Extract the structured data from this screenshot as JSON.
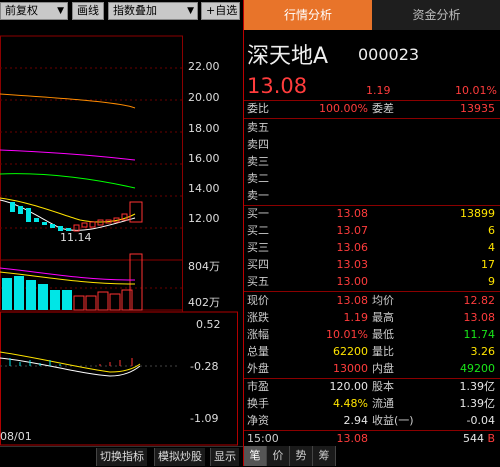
{
  "toolbar": {
    "adjust_label": "前复权",
    "line_label": "画线",
    "overlay_label": "指数叠加",
    "custom_label": "+自选"
  },
  "chart": {
    "price_axis": [
      "22.00",
      "20.00",
      "18.00",
      "16.00",
      "14.00",
      "12.00"
    ],
    "low_label": "11.14",
    "vol_axis": [
      "804万",
      "402万"
    ],
    "macd_axis": [
      "0.52",
      "-0.28",
      "-1.09"
    ],
    "date_label": "08/01",
    "colors": {
      "up": "#ff3232",
      "down": "#00e6e6",
      "ma5": "#ffffff",
      "ma10": "#ffe400",
      "ma20": "#ff00ff",
      "ma60": "#00ff00",
      "ma120": "#ff8c00"
    }
  },
  "bottombar": {
    "switch_label": "切换指标",
    "sim_label": "模拟炒股",
    "show_label": "显示"
  },
  "panel": {
    "tab_active": "行情分析",
    "tab_other": "资金分析",
    "name": "深天地A",
    "code": "000023",
    "price": "13.08",
    "change": "1.19",
    "change_pct": "10.01%",
    "weibi_label": "委比",
    "weibi": "100.00%",
    "weicha_label": "委差",
    "weicha": "13935",
    "asks": [
      {
        "label": "卖五",
        "price": "",
        "vol": ""
      },
      {
        "label": "卖四",
        "price": "",
        "vol": ""
      },
      {
        "label": "卖三",
        "price": "",
        "vol": ""
      },
      {
        "label": "卖二",
        "price": "",
        "vol": ""
      },
      {
        "label": "卖一",
        "price": "",
        "vol": ""
      }
    ],
    "bids": [
      {
        "label": "买一",
        "price": "13.08",
        "vol": "13899"
      },
      {
        "label": "买二",
        "price": "13.07",
        "vol": "6"
      },
      {
        "label": "买三",
        "price": "13.06",
        "vol": "4"
      },
      {
        "label": "买四",
        "price": "13.03",
        "vol": "17"
      },
      {
        "label": "买五",
        "price": "13.00",
        "vol": "9"
      }
    ],
    "stats": [
      {
        "l1": "现价",
        "v1": "13.08",
        "c1": "red",
        "l2": "均价",
        "v2": "12.82",
        "c2": "red"
      },
      {
        "l1": "涨跌",
        "v1": "1.19",
        "c1": "red",
        "l2": "最高",
        "v2": "13.08",
        "c2": "red"
      },
      {
        "l1": "涨幅",
        "v1": "10.01%",
        "c1": "red",
        "l2": "最低",
        "v2": "11.74",
        "c2": "grn"
      },
      {
        "l1": "总量",
        "v1": "62200",
        "c1": "yel",
        "l2": "量比",
        "v2": "3.26",
        "c2": "yel"
      },
      {
        "l1": "外盘",
        "v1": "13000",
        "c1": "red",
        "l2": "内盘",
        "v2": "49200",
        "c2": "grn"
      },
      {
        "l1": "市盈",
        "v1": "120.00",
        "c1": "wht",
        "l2": "股本",
        "v2": "1.39亿",
        "c2": "wht"
      },
      {
        "l1": "换手",
        "v1": "4.48%",
        "c1": "yel",
        "l2": "流通",
        "v2": "1.39亿",
        "c2": "wht"
      },
      {
        "l1": "净资",
        "v1": "2.94",
        "c1": "wht",
        "l2": "收益(一)",
        "v2": "-0.04",
        "c2": "wht"
      }
    ],
    "last_trade": {
      "time": "15:00",
      "price": "13.08",
      "vol": "544",
      "side": "B"
    },
    "footer_tabs": [
      "笔",
      "价",
      "势",
      "筹"
    ]
  }
}
